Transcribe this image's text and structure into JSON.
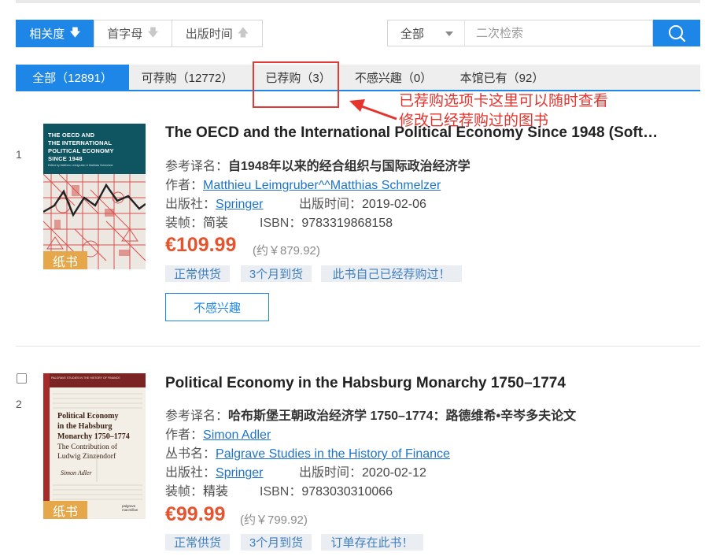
{
  "sort": {
    "relevance": "相关度",
    "initial": "首字母",
    "pubdate": "出版时间"
  },
  "search": {
    "scope": "全部",
    "placeholder": "二次检索"
  },
  "tabs": [
    {
      "label": "全部（12891）"
    },
    {
      "label": "可荐购（12772）"
    },
    {
      "label": "已荐购（3）"
    },
    {
      "label": "不感兴趣（0）"
    },
    {
      "label": "本馆已有（92）"
    }
  ],
  "annotation": {
    "line1": "已荐购选项卡这里可以随时查看",
    "line2": "修改已经荐购过的图书"
  },
  "labels": {
    "ref_title": "参考译名：",
    "author": "作者：",
    "series": "丛书名：",
    "publisher": "出版社：",
    "pubdate": "出版时间：",
    "binding": "装帧：",
    "isbn": "ISBN：",
    "badge": "纸书",
    "not_interested": "不感兴趣"
  },
  "items": [
    {
      "index": "1",
      "title": "The OECD and the International Political Economy Since 1948 (Softc...",
      "ref_title": "自1948年以来的经合组织与国际政治经济学",
      "author": "Matthieu Leimgruber^^Matthias Schmelzer",
      "publisher": "Springer",
      "pubdate": "2019-02-06",
      "binding": "简装",
      "isbn": "9783319868158",
      "price": "€109.99",
      "price_cny": "(约￥879.92)",
      "tags": [
        "正常供货",
        "3个月到货",
        "此书自己已经荐购过！"
      ],
      "cover": {
        "title_lines": [
          "THE OECD AND",
          "THE INTERNATIONAL",
          "POLITICAL ECONOMY",
          "SINCE 1948"
        ],
        "subtitle": "Edited by Matthieu Leimgruber & Matthias Schmelzer"
      }
    },
    {
      "index": "2",
      "title": "Political Economy in the Habsburg Monarchy 1750–1774",
      "ref_title": "哈布斯堡王朝政治经济学 1750–1774：路德维希•辛岑多夫论文",
      "author": "Simon Adler",
      "series": "Palgrave Studies in the History of Finance",
      "publisher": "Springer",
      "pubdate": "2020-02-12",
      "binding": "精装",
      "isbn": "9783030310066",
      "price": "€99.99",
      "price_cny": "(约￥799.92)",
      "tags": [
        "正常供货",
        "3个月到货",
        "订单存在此书！"
      ],
      "cover": {
        "header": "PALGRAVE STUDIES IN THE HISTORY OF FINANCE",
        "title_lines": [
          "Political Economy",
          "in the Habsburg",
          "Monarchy 1750–1774"
        ],
        "subtitle_lines": [
          "The Contribution of",
          "Ludwig Zinzendorf"
        ],
        "author": "Simon Adler",
        "publisher_mark": "palgrave macmillan"
      }
    }
  ],
  "colors": {
    "accent": "#1e86e6",
    "price": "#e4542f",
    "badge": "#e6a64a",
    "annotation": "#e5342d"
  }
}
